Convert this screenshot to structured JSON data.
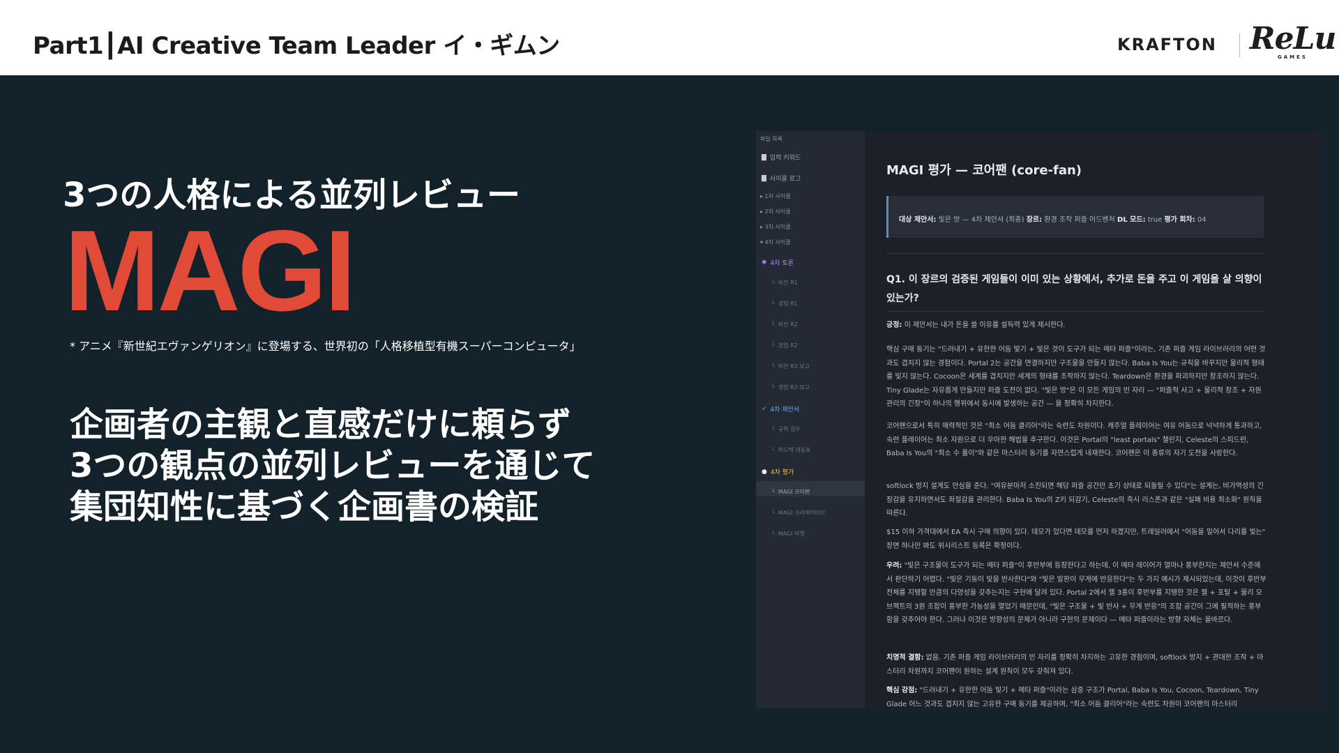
{
  "header": {
    "title": "Part1┃AI Creative Team Leader イ・ギムン",
    "logo_krafton": "KRAFTON",
    "logo_relu": "ReLu",
    "logo_games": "GAMES"
  },
  "hero": {
    "subtitle": "3つの人格による並列レビュー",
    "name": "MAGI",
    "footnote": "* アニメ『新世紀エヴァンゲリオン』に登場する、世界初の「人格移植型有機スーパーコンピュータ」",
    "description_lines": [
      "企画者の主観と直感だけに頼らず",
      "3つの観点の並列レビューを通じて",
      "集団知性に基づく企画書の検証"
    ]
  },
  "colors": {
    "background": "#13212b",
    "accent": "#e04a37"
  },
  "app": {
    "sidebar": {
      "header": "파일 목록",
      "items": [
        {
          "label": "입력 키워드",
          "icon": "file-icon"
        },
        {
          "label": "사이클 로그",
          "icon": "file-icon"
        },
        {
          "label": "▸ 1차 사이클"
        },
        {
          "label": "▸ 2차 사이클"
        },
        {
          "label": "▸ 3차 사이클"
        },
        {
          "label": "▾ 4차 사이클"
        },
        {
          "label": "4차 토론",
          "icon": "spark-icon"
        },
        {
          "label": "비전 R1"
        },
        {
          "label": "경험 R1"
        },
        {
          "label": "비전 R2"
        },
        {
          "label": "경험 R2"
        },
        {
          "label": "비전 R3 보고"
        },
        {
          "label": "경험 R3 보고"
        },
        {
          "label": "4차 제안서",
          "icon": "check-icon"
        },
        {
          "label": "규칙 검수"
        },
        {
          "label": "피드백 대응표"
        },
        {
          "label": "4차 평가",
          "icon": "chat-icon"
        },
        {
          "label": "MAGI 코어팬"
        },
        {
          "label": "MAGI 크리에이티브"
        },
        {
          "label": "MAGI 마켓"
        }
      ]
    },
    "main": {
      "title": "MAGI 평가 — 코어팬 (core-fan)",
      "meta": {
        "k1": "대상 제안서:",
        "v1": " 빛은 방 — 4차 제안서 (최종) ",
        "k2": "장르:",
        "v2": " 환경 조작 퍼즐 어드벤처 ",
        "k3": "DL 모드:",
        "v3": " true ",
        "k4": "평가 회차:",
        "v4": " 04"
      },
      "question": "Q1. 이 장르의 검증된 게임들이 이미 있는 상황에서, 추가로 돈을 주고 이 게임을 살 의향이 있는가?",
      "paragraphs": [
        {
          "lead": "긍정:",
          "text": " 이 제안서는 내가 돈을 쓸 이유를 설득력 있게 제시한다."
        },
        {
          "lead": "",
          "text": "핵심 구매 동기는 \"드러내기 + 유한한 어둠 빛기 + 빛은 것이 도구가 되는 메타 퍼즐\"이라는, 기존 퍼즐 게임 라이브러리의 어떤 것과도 겹치지 않는 경험이다. Portal 2는 공간을 연결하지만 구조물을 만들지 않는다. Baba Is You는 규칙을 바꾸지만 물리적 형태를 빛지 않는다. Cocoon은 세계를 겹치지만 세계의 형태를 조작하지 않는다. Teardown은 환경을 파괴하지만 창조하지 않는다. Tiny Glade는 자유롭게 만들지만 퍼즐 도전이 없다. \"빛은 방\"은 이 모든 게임의 빈 자리 — \"퍼즐적 사고 + 물리적 창조 + 자원 관리의 긴장\"이 하나의 행위에서 동시에 발생하는 공간 — 을 정확히 차지한다."
        },
        {
          "lead": "",
          "text": "코어팬으로서 특히 매력적인 것은 \"최소 어둠 클리어\"라는 숙련도 차원이다. 캐주얼 플레이어는 여유 어둠으로 넉넉하게 통과하고, 숙련 플레이어는 최소 자원으로 더 우아한 해법을 추구한다. 이것은 Portal의 \"least portals\" 챌린지, Celeste의 스피드런, Baba Is You의 \"최소 수 풀이\"와 같은 마스터리 동기를 자연스럽게 내재한다. 코어팬은 이 종류의 자기 도전을 사랑한다."
        },
        {
          "lead": "",
          "text": "softlock 방지 설계도 안심을 준다. \"여유분마저 소진되면 해당 퍼즐 공간만 초기 상태로 되돌릴 수 있다\"는 설계는, 비가역성의 긴장감을 유지하면서도 좌절감을 관리한다. Baba Is You의 Z키 되감기, Celeste의 즉시 리스폰과 같은 \"실패 비용 최소화\" 원칙을 따른다."
        },
        {
          "lead": "",
          "text": "$15 이하 가격대에서 EA 즉시 구매 의향이 있다. 데모가 있다면 데모를 먼저 하겠지만, 트레일러에서 \"어둠을 밀어서 다리를 빛는\" 장면 하나만 봐도 위시리스트 등록은 확정이다."
        },
        {
          "lead": "우려:",
          "text": " \"빛은 구조물이 도구가 되는 메타 퍼즐\"이 후반부에 등장한다고 하는데, 이 메타 레이어가 얼마나 풍부한지는 제안서 수준에서 판단하기 어렵다. \"빛은 기둥이 빛을 반사한다\"와 \"빛은 발판이 무게에 반응한다\"는 두 가지 예시가 제시되었는데, 이것이 후반부 전체를 지탱할 만큼의 다양성을 갖추는지는 구현에 달려 있다. Portal 2에서 젤 3종이 후반부를 지탱한 것은 젤 + 포탈 + 물리 오브젝트의 3원 조합이 풍부한 가능성을 열었기 때문인데, \"빛은 구조물 + 빛 반사 + 무게 반응\"의 조합 공간이 그에 필적하는 풍부함을 갖추어야 한다. 그러나 이것은 방향성의 문제가 아니라 구현의 문제이다 — 메타 퍼즐이라는 방향 자체는 올바르다."
        },
        {
          "lead": "치명적 결함:",
          "text": " 없음. 기존 퍼즐 게임 라이브러리의 빈 자리를 정확히 차지하는 고유한 경험이며, softlock 방지 + 관대한 조작 + 마스터리 차원까지 코어팬이 원하는 설계 원칙이 모두 갖춰져 있다."
        },
        {
          "lead": "핵심 강점:",
          "text": " \"드러내기 + 유한한 어둠 빛기 + 메타 퍼즐\"이라는 삼중 구조가 Portal, Baba Is You, Cocoon, Teardown, Tiny Glade 어느 것과도 겹치지 않는 고유한 구매 동기를 제공하며, \"최소 어둠 클리어\"라는 숙련도 차원이 코어팬의 마스터리"
        }
      ]
    }
  }
}
